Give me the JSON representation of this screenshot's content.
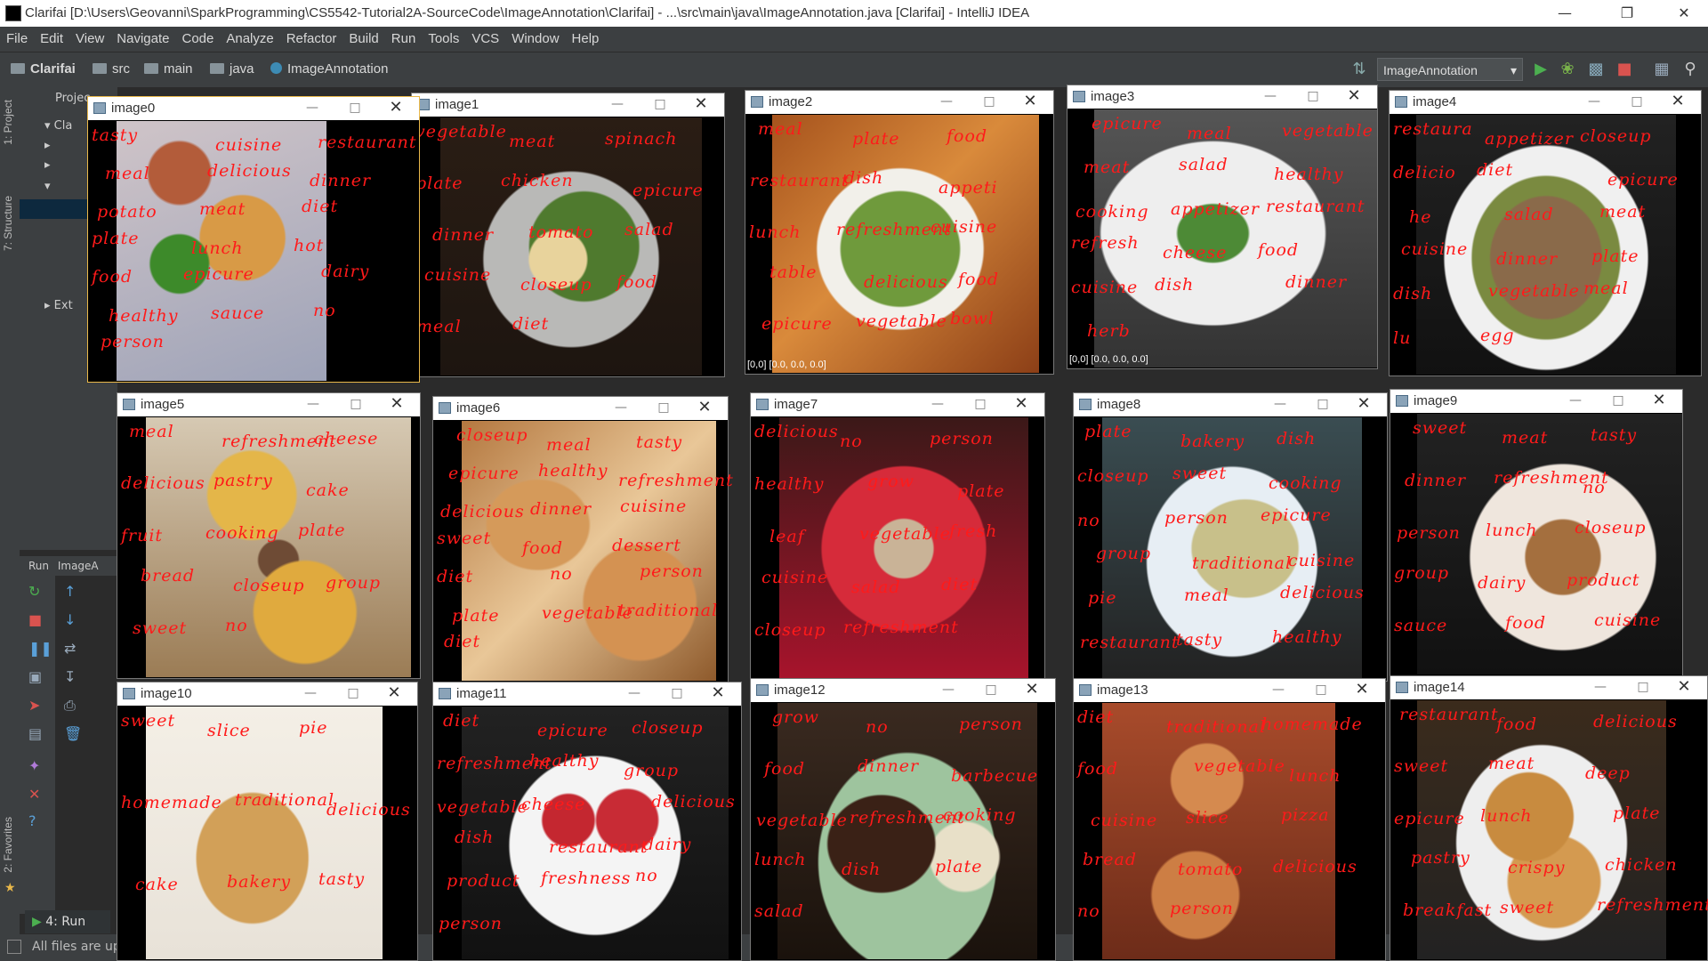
{
  "window": {
    "title": "Clarifai [D:\\Users\\Geovanni\\SparkProgramming\\CS5542-Tutorial2A-SourceCode\\ImageAnnotation\\Clarifai] - ...\\src\\main\\java\\ImageAnnotation.java [Clarifai] - IntelliJ IDEA"
  },
  "menu": [
    "File",
    "Edit",
    "View",
    "Navigate",
    "Code",
    "Analyze",
    "Refactor",
    "Build",
    "Run",
    "Tools",
    "VCS",
    "Window",
    "Help"
  ],
  "breadcrumb": [
    "Clarifai",
    "src",
    "main",
    "java",
    "ImageAnnotation"
  ],
  "run_config": "ImageAnnotation",
  "tool_tabs": {
    "project": "1: Project",
    "structure": "7: Structure",
    "favorites": "2: Favorites"
  },
  "project_header": "Projec",
  "tree_items": [
    "Cla",
    "Ext"
  ],
  "run_tab": {
    "label": "Run",
    "config": "ImageA"
  },
  "bottom_tab": "4: Run",
  "status": "All files are up",
  "coord_text": "[0,0] [0.0, 0.0, 0.0]",
  "images": [
    {
      "name": "image0",
      "labels": [
        "tasty",
        "cuisine",
        "restaurant",
        "meal",
        "delicious",
        "dinner",
        "potato",
        "meat",
        "diet",
        "plate",
        "lunch",
        "hot",
        "food",
        "epicure",
        "dairy",
        "healthy",
        "sauce",
        "no",
        "person"
      ]
    },
    {
      "name": "image1",
      "labels": [
        "vegetable",
        "meat",
        "spinach",
        "plate",
        "chicken",
        "epicure",
        "dinner",
        "tomato",
        "salad",
        "cuisine",
        "closeup",
        "food",
        "meal",
        "diet"
      ]
    },
    {
      "name": "image2",
      "labels": [
        "meal",
        "plate",
        "food",
        "restaurant",
        "dish",
        "appeti",
        "lunch",
        "refreshment",
        "cuisine",
        "table",
        "delicious",
        "food",
        "epicure",
        "vegetable",
        "bowl"
      ]
    },
    {
      "name": "image3",
      "labels": [
        "epicure",
        "meal",
        "vegetable",
        "meat",
        "salad",
        "healthy",
        "cooking",
        "appetizer",
        "restaurant",
        "refresh",
        "cheese",
        "food",
        "cuisine",
        "dish",
        "dinner",
        "herb"
      ]
    },
    {
      "name": "image4",
      "labels": [
        "restaura",
        "appetizer",
        "closeup",
        "delicio",
        "diet",
        "epicure",
        "he",
        "salad",
        "meat",
        "cuisine",
        "dinner",
        "plate",
        "dish",
        "vegetable",
        "meal",
        "lu",
        "egg"
      ]
    },
    {
      "name": "image5",
      "labels": [
        "meal",
        "refreshment",
        "cheese",
        "delicious",
        "pastry",
        "cake",
        "fruit",
        "cooking",
        "plate",
        "bread",
        "closeup",
        "group",
        "sweet",
        "no"
      ]
    },
    {
      "name": "image6",
      "labels": [
        "closeup",
        "meal",
        "tasty",
        "epicure",
        "healthy",
        "refreshment",
        "delicious",
        "dinner",
        "cuisine",
        "sweet",
        "food",
        "dessert",
        "diet",
        "no",
        "person",
        "plate",
        "vegetable",
        "traditional",
        "diet"
      ]
    },
    {
      "name": "image7",
      "labels": [
        "delicious",
        "no",
        "person",
        "healthy",
        "grow",
        "plate",
        "leaf",
        "vegetable",
        "fresh",
        "cuisine",
        "salad",
        "diet",
        "closeup",
        "refreshment"
      ]
    },
    {
      "name": "image8",
      "labels": [
        "plate",
        "bakery",
        "dish",
        "closeup",
        "sweet",
        "cooking",
        "no",
        "person",
        "epicure",
        "group",
        "traditional",
        "cuisine",
        "pie",
        "meal",
        "delicious",
        "restaurant",
        "tasty",
        "healthy"
      ]
    },
    {
      "name": "image9",
      "labels": [
        "sweet",
        "meat",
        "tasty",
        "dinner",
        "refreshment",
        "no",
        "person",
        "lunch",
        "closeup",
        "group",
        "dairy",
        "product",
        "sauce",
        "food",
        "cuisine"
      ]
    },
    {
      "name": "image10",
      "labels": [
        "sweet",
        "slice",
        "pie",
        "homemade",
        "traditional",
        "delicious",
        "cake",
        "bakery",
        "tasty"
      ]
    },
    {
      "name": "image11",
      "labels": [
        "diet",
        "epicure",
        "closeup",
        "refreshment",
        "healthy",
        "group",
        "vegetable",
        "cheese",
        "delicious",
        "dish",
        "restaurant",
        "dairy",
        "product",
        "freshness",
        "no",
        "person"
      ]
    },
    {
      "name": "image12",
      "labels": [
        "grow",
        "no",
        "person",
        "food",
        "dinner",
        "barbecue",
        "vegetable",
        "refreshment",
        "cooking",
        "lunch",
        "dish",
        "plate",
        "salad"
      ]
    },
    {
      "name": "image13",
      "labels": [
        "diet",
        "traditional",
        "homemade",
        "food",
        "vegetable",
        "lunch",
        "cuisine",
        "slice",
        "pizza",
        "bread",
        "tomato",
        "delicious",
        "no",
        "person"
      ]
    },
    {
      "name": "image14",
      "labels": [
        "restaurant",
        "food",
        "delicious",
        "sweet",
        "meat",
        "deep",
        "epicure",
        "lunch",
        "plate",
        "pastry",
        "crispy",
        "chicken",
        "breakfast",
        "sweet",
        "refreshment"
      ]
    }
  ],
  "colors": {
    "label": "#ff1a1a",
    "ide_bg": "#2b2b2b",
    "chrome": "#3c3f41",
    "active_border": "#e9b84a"
  }
}
